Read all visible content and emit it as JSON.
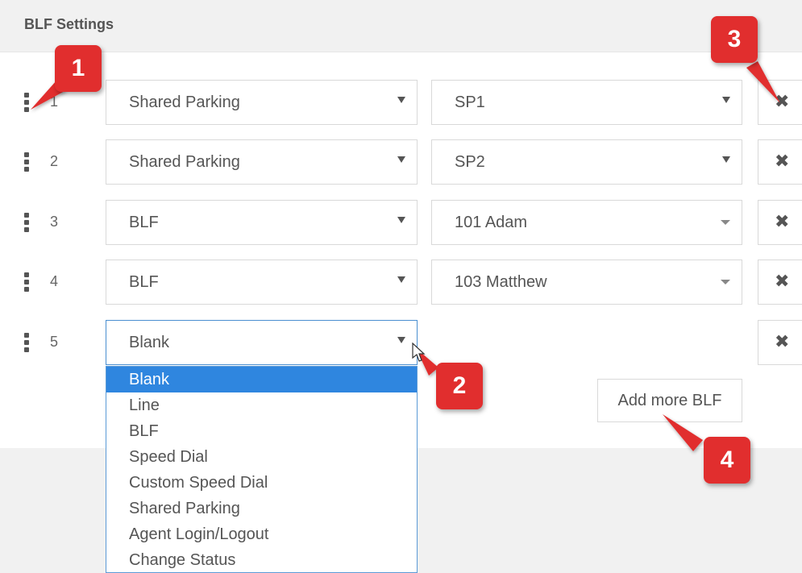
{
  "header": {
    "title": "BLF Settings"
  },
  "rows": [
    {
      "number": "1",
      "type": "Shared Parking",
      "value": "SP1"
    },
    {
      "number": "2",
      "type": "Shared Parking",
      "value": "SP2"
    },
    {
      "number": "3",
      "type": "BLF",
      "value": "101 Adam"
    },
    {
      "number": "4",
      "type": "BLF",
      "value": "103 Matthew"
    },
    {
      "number": "5",
      "type": "Blank",
      "value": ""
    }
  ],
  "delete_glyph": "✖",
  "dropdown": {
    "options": [
      "Blank",
      "Line",
      "BLF",
      "Speed Dial",
      "Custom Speed Dial",
      "Shared Parking",
      "Agent Login/Logout",
      "Change Status"
    ],
    "selected": "Blank"
  },
  "add_button": {
    "label": "Add more BLF"
  },
  "callouts": [
    {
      "label": "1"
    },
    {
      "label": "2"
    },
    {
      "label": "3"
    },
    {
      "label": "4"
    }
  ],
  "colors": {
    "callout": "#e12e2e",
    "highlight": "#2f86df",
    "focus_border": "#4a8fd0"
  }
}
